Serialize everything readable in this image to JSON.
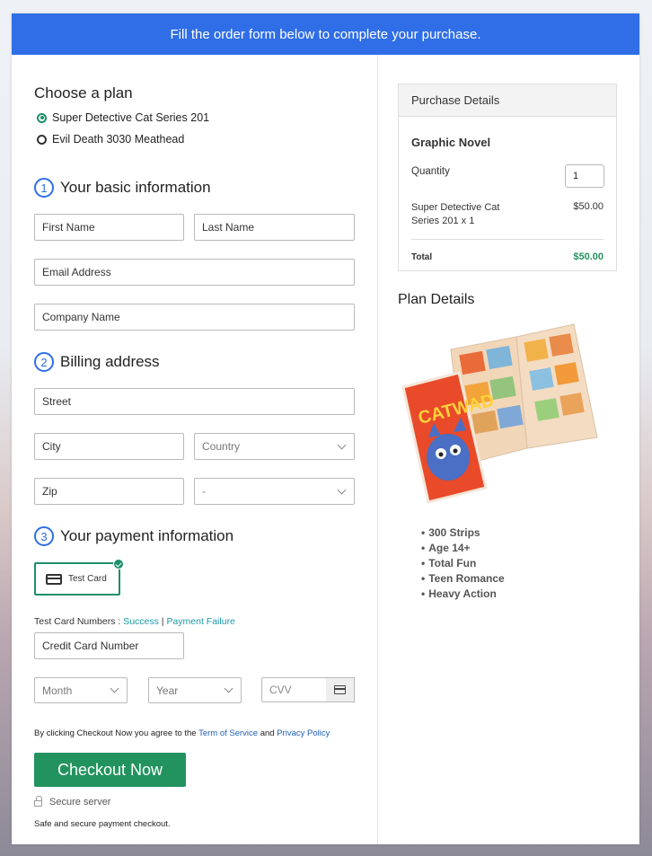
{
  "banner": {
    "text": "Fill the order form below to complete your purchase."
  },
  "plan": {
    "heading": "Choose a plan",
    "options": [
      {
        "label": "Super Detective Cat Series 201",
        "selected": true
      },
      {
        "label": "Evil Death 3030 Meathead",
        "selected": false
      }
    ]
  },
  "basic": {
    "num": "1",
    "title": "Your basic information",
    "first_name_placeholder": "First Name",
    "last_name_placeholder": "Last Name",
    "email_placeholder": "Email Address",
    "company_placeholder": "Company Name"
  },
  "billing": {
    "num": "2",
    "title": "Billing address",
    "street_placeholder": "Street",
    "city_placeholder": "City",
    "country_selected": "Country",
    "zip_placeholder": "Zip",
    "state_selected": "-"
  },
  "payment": {
    "num": "3",
    "title": "Your payment information",
    "card_option": "Test Card",
    "test_numbers_label": "Test Card Numbers : ",
    "success_link": "Success",
    "separator": " | ",
    "failure_link": "Payment Failure",
    "card_number_placeholder": "Credit Card Number",
    "month_selected": "Month",
    "year_selected": "Year",
    "cvv_placeholder": "CVV"
  },
  "terms": {
    "prefix": "By clicking Checkout Now you agree to the ",
    "tos_link": "Term of Service",
    "and": " and ",
    "privacy_link": "Privacy Policy"
  },
  "checkout": {
    "button_label": "Checkout Now",
    "secure_label": "Secure server",
    "safe_text": "Safe and secure payment checkout."
  },
  "purchase": {
    "heading": "Purchase Details",
    "product": "Graphic Novel",
    "quantity_label": "Quantity",
    "quantity_value": "1",
    "line_item_1": "Super Detective Cat",
    "line_item_2": "Series 201 x 1",
    "line_price": "$50.00",
    "total_label": "Total",
    "total_value": "$50.00",
    "total_color": "#22935e"
  },
  "plan_details": {
    "heading": "Plan Details",
    "cover_title": "CATWAD",
    "features": [
      "300 Strips",
      "Age 14+",
      "Total Fun",
      "Teen Romance",
      "Heavy Action"
    ]
  },
  "colors": {
    "banner": "#2f6ee6",
    "accent_green": "#22935e",
    "step_blue": "#2f6ee6"
  }
}
